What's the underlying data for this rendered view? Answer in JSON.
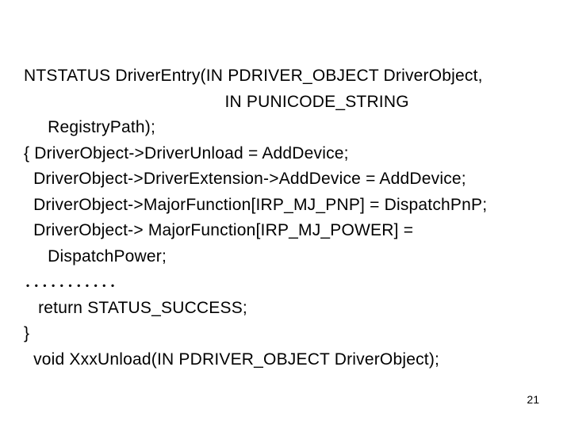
{
  "lines": [
    "NTSTATUS DriverEntry(IN PDRIVER_OBJECT DriverObject,",
    "                                          IN PUNICODE_STRING",
    "     RegistryPath);",
    "{ DriverObject->DriverUnload = AddDevice;",
    "  DriverObject->DriverExtension->AddDevice = AddDevice;",
    "  DriverObject->MajorFunction[IRP_MJ_PNP] = DispatchPnP;",
    "  DriverObject-> MajorFunction[IRP_MJ_POWER] =",
    "     DispatchPower;",
    "．．．．．．．．．．．",
    "   return STATUS_SUCCESS;",
    "}",
    "",
    "  void XxxUnload(IN PDRIVER_OBJECT DriverObject);"
  ],
  "page_number": "21"
}
